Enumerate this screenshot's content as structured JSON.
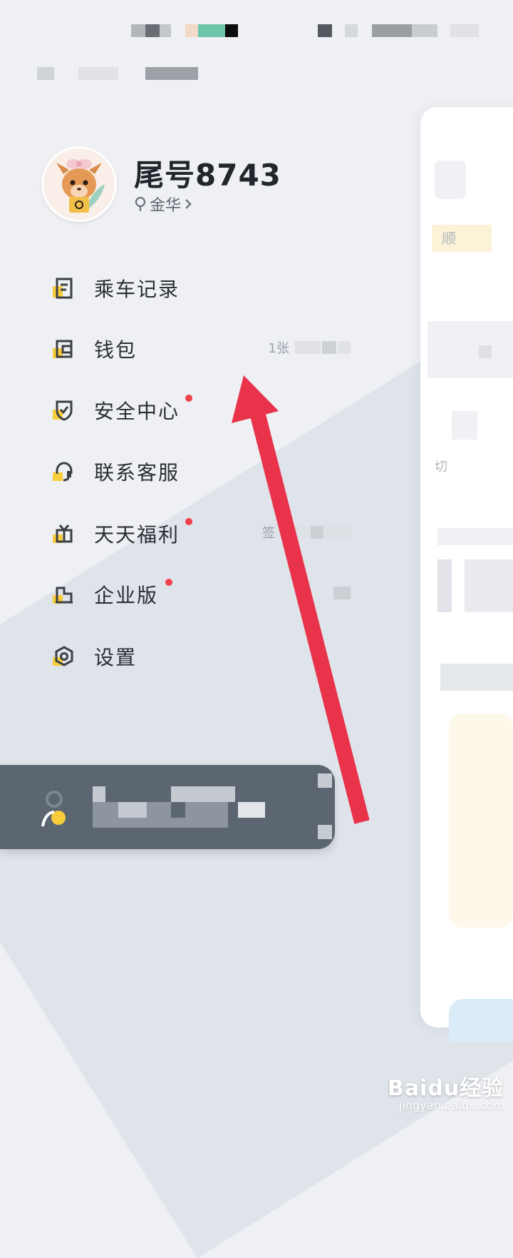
{
  "profile": {
    "username": "尾号8743",
    "location": "金华"
  },
  "menu": {
    "items": [
      {
        "label": "乘车记录",
        "icon": "trip-record-icon",
        "dot": false,
        "trail": ""
      },
      {
        "label": "钱包",
        "icon": "wallet-icon",
        "dot": false,
        "trail": "1张"
      },
      {
        "label": "安全中心",
        "icon": "shield-icon",
        "dot": true,
        "trail": ""
      },
      {
        "label": "联系客服",
        "icon": "headset-icon",
        "dot": false,
        "trail": ""
      },
      {
        "label": "天天福利",
        "icon": "gift-icon",
        "dot": true,
        "trail": "签"
      },
      {
        "label": "企业版",
        "icon": "building-icon",
        "dot": true,
        "trail": ""
      },
      {
        "label": "设置",
        "icon": "gear-icon",
        "dot": false,
        "trail": ""
      }
    ]
  },
  "background_app": {
    "label_1": "顺",
    "label_2": "切"
  },
  "watermark": {
    "logo": "Baidu经验",
    "url": "jingyan.baidu.com"
  },
  "colors": {
    "accent_yellow": "#f7cd3c",
    "dot_red": "#f0414c",
    "arrow_red": "#e8334a",
    "promo_bar": "#5b6671"
  }
}
